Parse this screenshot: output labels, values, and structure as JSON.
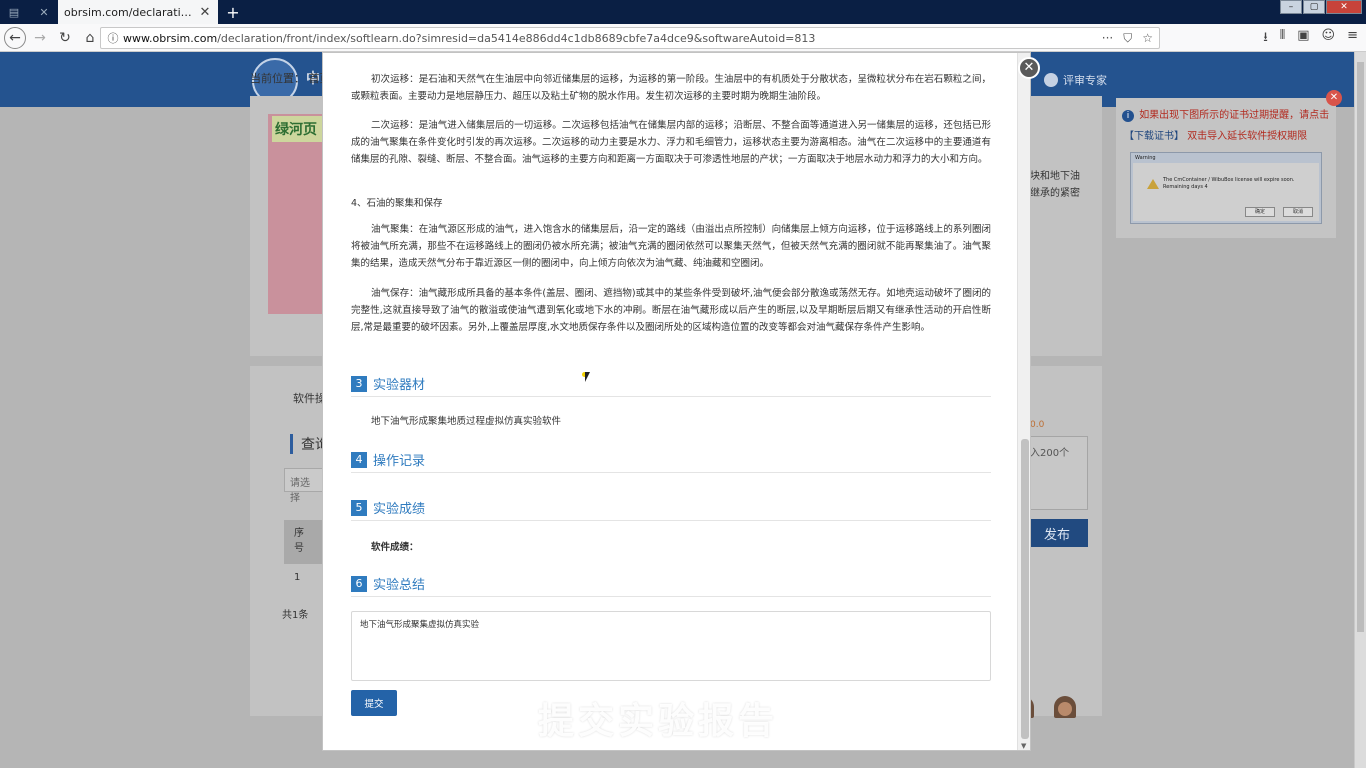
{
  "browser": {
    "tab_title": "obrsim.com/declaration/front/in",
    "tab_close": "✕",
    "new_tab": "+",
    "url_domain": "www.obrsim.com",
    "url_path": "/declaration/front/index/softlearn.do?simresid=da5414e886dd4c1db8689cbfe7a4dce9&softwareAutoid=813",
    "url_icons": [
      "···",
      "⛉",
      "☆"
    ],
    "toolbar_icons": [
      "⭳",
      "⫴",
      "▣",
      "☺",
      "≡"
    ]
  },
  "site": {
    "logo_text": "中",
    "expert_label": "评审专家",
    "breadcrumb": "当前位置：  首页",
    "book_title": "绿河页",
    "side_text": [
      "块和地下油",
      "继承的紧密"
    ],
    "sw_label": "软件操",
    "query_label": "查询",
    "select_hint": "请选择",
    "table_head": "序号",
    "table_cell": "1",
    "total_label": "共1条",
    "orange_num": "0.0",
    "count_text": "入200个",
    "publish_btn": "发布"
  },
  "notice": {
    "close": "✕",
    "info": "i",
    "line1": "如果出现下图所示的证书过期提醒，请点击",
    "link": "【下载证书】",
    "line2": "双击导入延长软件授权期限",
    "warn_title": "Warning",
    "warn_text": "The CmContainer / WibuBox license will expire soon. Remaining days 4",
    "btn_ok": "确定",
    "btn_cancel": "取消"
  },
  "modal": {
    "close": "✕",
    "p1": "初次运移：是石油和天然气在生油层中向邻近储集层的运移，为运移的第一阶段。生油层中的有机质处于分散状态，呈微粒状分布在岩石颗粒之间，或颗粒表面。主要动力是地层静压力、超压以及粘土矿物的脱水作用。发生初次运移的主要时期为晚期生油阶段。",
    "p2": "二次运移：是油气进入储集层后的一切运移。二次运移包括油气在储集层内部的运移；沿断层、不整合面等通道进入另一储集层的运移，还包括已形成的油气聚集在条件变化时引发的再次运移。二次运移的动力主要是水力、浮力和毛细管力，运移状态主要为游离相态。油气在二次运移中的主要通道有储集层的孔隙、裂缝、断层、不整合面。油气运移的主要方向和距离一方面取决于可渗透性地层的产状；一方面取决于地层水动力和浮力的大小和方向。",
    "sub4": "4、石油的聚集和保存",
    "p3": "油气聚集：在油气源区形成的油气，进入饱含水的储集层后，沿一定的路线（由溢出点所控制）向储集层上倾方向运移，位于运移路线上的系列圈闭将被油气所充满，那些不在运移路线上的圈闭仍被水所充满；被油气充满的圈闭依然可以聚集天然气，但被天然气充满的圈闭就不能再聚集油了。油气聚集的结果，造成天然气分布于靠近源区一侧的圈闭中，向上倾方向依次为油气藏、纯油藏和空圈闭。",
    "p4": "油气保存：油气藏形成所具备的基本条件(盖层、圈闭、遮挡物)或其中的某些条件受到破坏,油气便会部分散逸或荡然无存。如地壳运动破坏了圈闭的完整性,这就直接导致了油气的散溢或使油气遭到氧化或地下水的冲刷。断层在油气藏形成以后产生的断层,以及早期断层后期又有继承性活动的开启性断层,常是最重要的破坏因素。另外,上覆盖层厚度,水文地质保存条件以及圈闭所处的区域构造位置的改变等都会对油气藏保存条件产生影响。",
    "sections": [
      {
        "num": "3",
        "title": "实验器材"
      },
      {
        "num": "4",
        "title": "操作记录"
      },
      {
        "num": "5",
        "title": "实验成绩"
      },
      {
        "num": "6",
        "title": "实验总结"
      }
    ],
    "equipment": "地下油气形成聚集地质过程虚拟仿真实验软件",
    "score_label": "软件成绩：",
    "summary_value": "地下油气形成聚集虚拟仿真实验",
    "submit_label": "提交"
  },
  "overlay_caption": "提交实验报告"
}
